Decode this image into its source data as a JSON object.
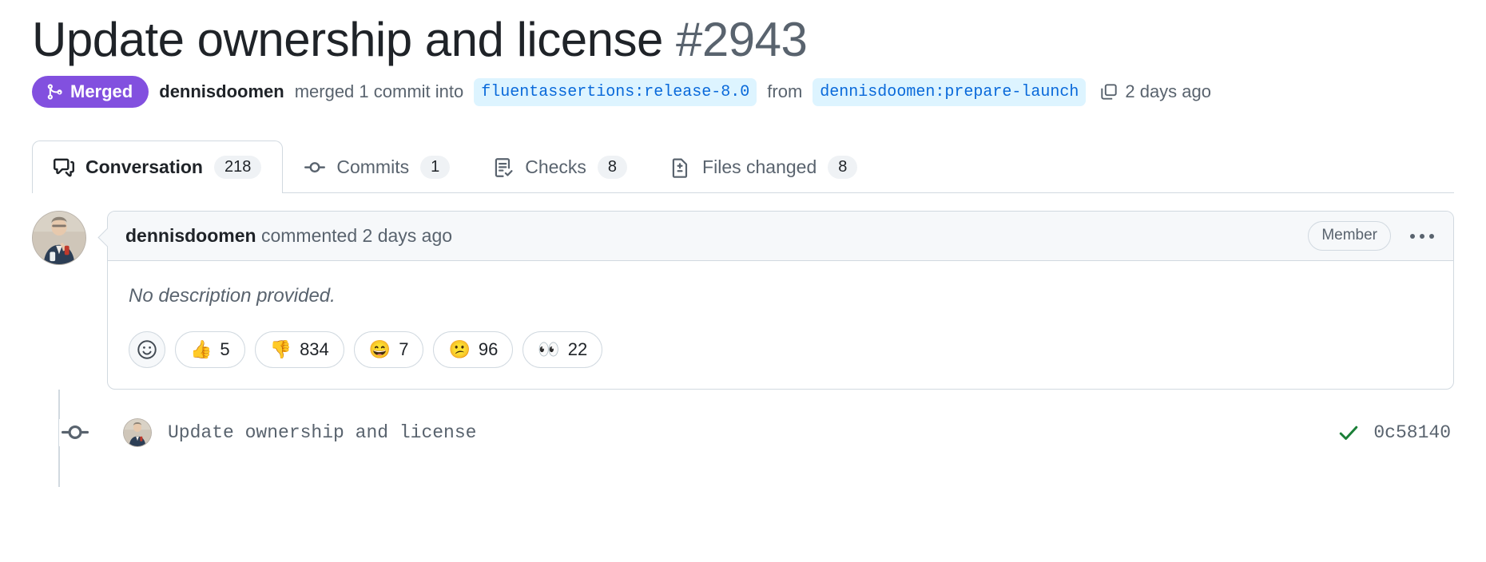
{
  "header": {
    "title": "Update ownership and license",
    "number": "#2943"
  },
  "state": {
    "badge_label": "Merged",
    "badge_icon": "git-merge-icon",
    "badge_color": "#8250df",
    "actor": "dennisdoomen",
    "merge_text": "merged 1 commit into",
    "base_branch": "fluentassertions:release-8.0",
    "from_text": "from",
    "head_branch": "dennisdoomen:prepare-launch",
    "copy_icon": "copy-icon",
    "timestamp": "2 days ago"
  },
  "tabs": [
    {
      "label": "Conversation",
      "count": "218",
      "icon": "comment-discussion-icon",
      "active": true
    },
    {
      "label": "Commits",
      "count": "1",
      "icon": "git-commit-icon",
      "active": false
    },
    {
      "label": "Checks",
      "count": "8",
      "icon": "checklist-icon",
      "active": false
    },
    {
      "label": "Files changed",
      "count": "8",
      "icon": "file-diff-icon",
      "active": false
    }
  ],
  "comment": {
    "author": "dennisdoomen",
    "action_text": "commented 2 days ago",
    "association_badge": "Member",
    "menu_icon": "kebab-horizontal-icon",
    "body": "No description provided.",
    "add_reaction_icon": "smiley-icon",
    "reactions": [
      {
        "emoji": "👍",
        "name": "thumbs-up",
        "count": "5"
      },
      {
        "emoji": "👎",
        "name": "thumbs-down",
        "count": "834"
      },
      {
        "emoji": "😄",
        "name": "laugh",
        "count": "7"
      },
      {
        "emoji": "😕",
        "name": "confused",
        "count": "96"
      },
      {
        "emoji": "👀",
        "name": "eyes",
        "count": "22"
      }
    ]
  },
  "commit_event": {
    "icon": "git-commit-icon",
    "message": "Update ownership and license",
    "status_icon": "check-icon",
    "status_color": "#1a7f37",
    "sha": "0c58140"
  }
}
